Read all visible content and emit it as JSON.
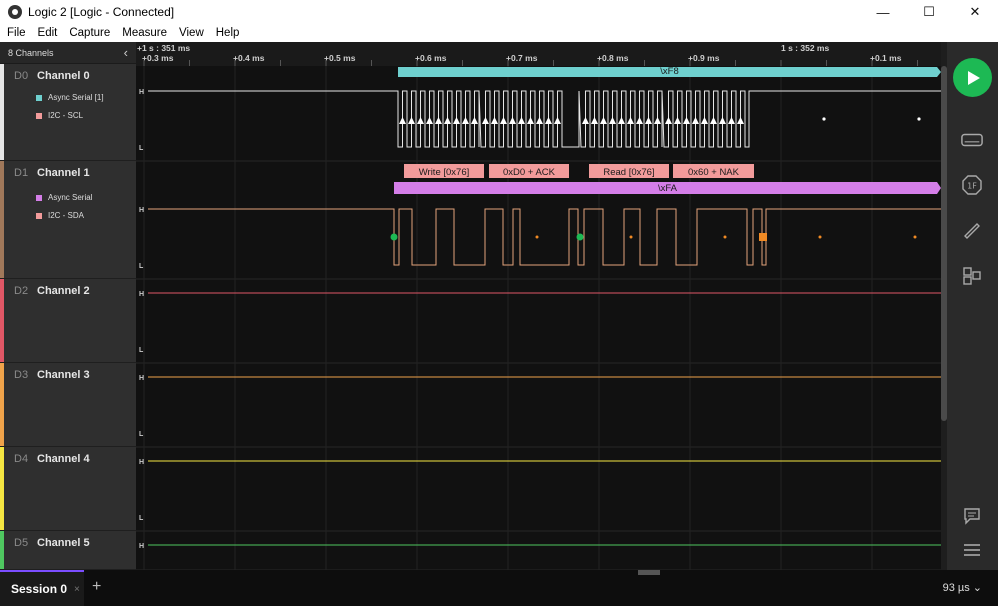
{
  "window": {
    "title": "Logic 2 [Logic - Connected]",
    "minimize": "—",
    "maximize": "☐",
    "close": "✕"
  },
  "menu": [
    "File",
    "Edit",
    "Capture",
    "Measure",
    "View",
    "Help"
  ],
  "channel_panel": {
    "header": "8 Channels",
    "collapse_icon": "chevron-left-icon"
  },
  "channels": [
    {
      "id": "D0",
      "name": "Channel 0",
      "color": "#e6e6e6",
      "analyzers": [
        {
          "name": "Async Serial [1]",
          "color": "#6fd0cf"
        },
        {
          "name": "I2C - SCL",
          "color": "#f29b9b"
        }
      ]
    },
    {
      "id": "D1",
      "name": "Channel 1",
      "color": "#a0785a",
      "analyzers": [
        {
          "name": "Async Serial",
          "color": "#d47ee8"
        },
        {
          "name": "I2C - SDA",
          "color": "#f29b9b"
        }
      ]
    },
    {
      "id": "D2",
      "name": "Channel 2",
      "color": "#e05766",
      "analyzers": []
    },
    {
      "id": "D3",
      "name": "Channel 3",
      "color": "#f0a34a",
      "analyzers": []
    },
    {
      "id": "D4",
      "name": "Channel 4",
      "color": "#f5e642",
      "analyzers": []
    },
    {
      "id": "D5",
      "name": "Channel 5",
      "color": "#4fc760",
      "analyzers": []
    }
  ],
  "timeline": {
    "markers": [
      "+1 s : 351 ms",
      "1 s : 352 ms"
    ],
    "ticks": [
      "+0.3 ms",
      "+0.4 ms",
      "+0.5 ms",
      "+0.6 ms",
      "+0.7 ms",
      "+0.8 ms",
      "+0.9 ms",
      "+0.1 ms"
    ]
  },
  "levels": {
    "high": "H",
    "low": "L"
  },
  "decoded": {
    "serial_ch0": "\\xF8",
    "serial_ch1": "\\xFA",
    "i2c": [
      "Write [0x76]",
      "0xD0 + ACK",
      "Read [0x76]",
      "0x60 + NAK"
    ]
  },
  "colors": {
    "serial_ch0": "#6fd0cf",
    "serial_ch1": "#d47ee8",
    "i2c": "#f29b9b",
    "start": "#1db954",
    "stop": "#f08a24",
    "accent": "#7b4dff"
  },
  "toolbar": {
    "play": "play-icon",
    "tools": [
      "device-icon",
      "analyzers-icon",
      "measure-icon",
      "extensions-icon",
      "chat-icon",
      "menu-icon"
    ]
  },
  "bottom": {
    "session": "Session 0",
    "session_close": "×",
    "add": "+",
    "timescale": "93 µs ⌄"
  }
}
